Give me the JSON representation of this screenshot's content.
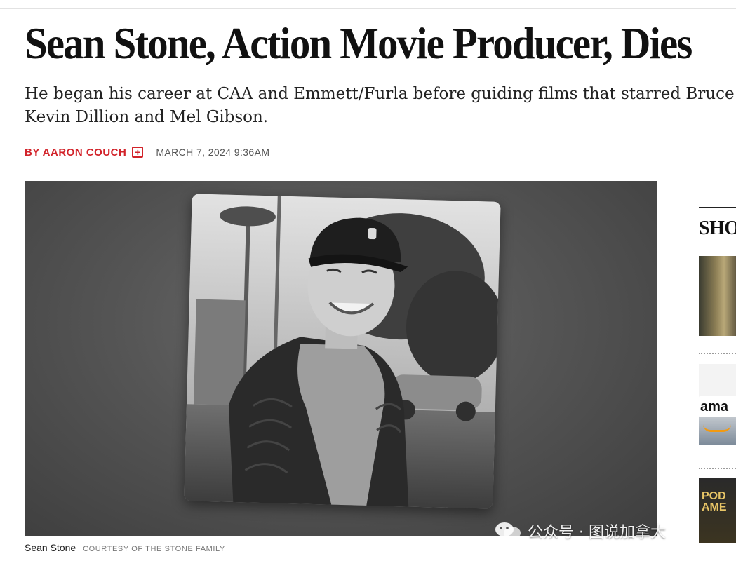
{
  "article": {
    "headline": "Sean Stone, Action Movie Producer, Dies",
    "dek_line1": "He began his career at CAA and Emmett/Furla before guiding films that starred Bruce",
    "dek_line2": "Kevin Dillion and Mel Gibson.",
    "byline": "BY AARON COUCH",
    "date": "MARCH 7, 2024 9:36AM",
    "photo_caption": "Sean Stone",
    "photo_credit": "COURTESY OF THE STONE FAMILY"
  },
  "sidebar": {
    "title": "SHO",
    "thumb2_text": "ama",
    "thumb3_line1": "POD",
    "thumb3_line2": "AME"
  },
  "watermark": {
    "text": "公众号 · 图说加拿大"
  },
  "colors": {
    "accent_red": "#d2232a",
    "text_dark": "#111111",
    "meta_gray": "#555555"
  },
  "icons": {
    "author_badge": "plus-square-icon",
    "watermark": "wechat-icon"
  }
}
